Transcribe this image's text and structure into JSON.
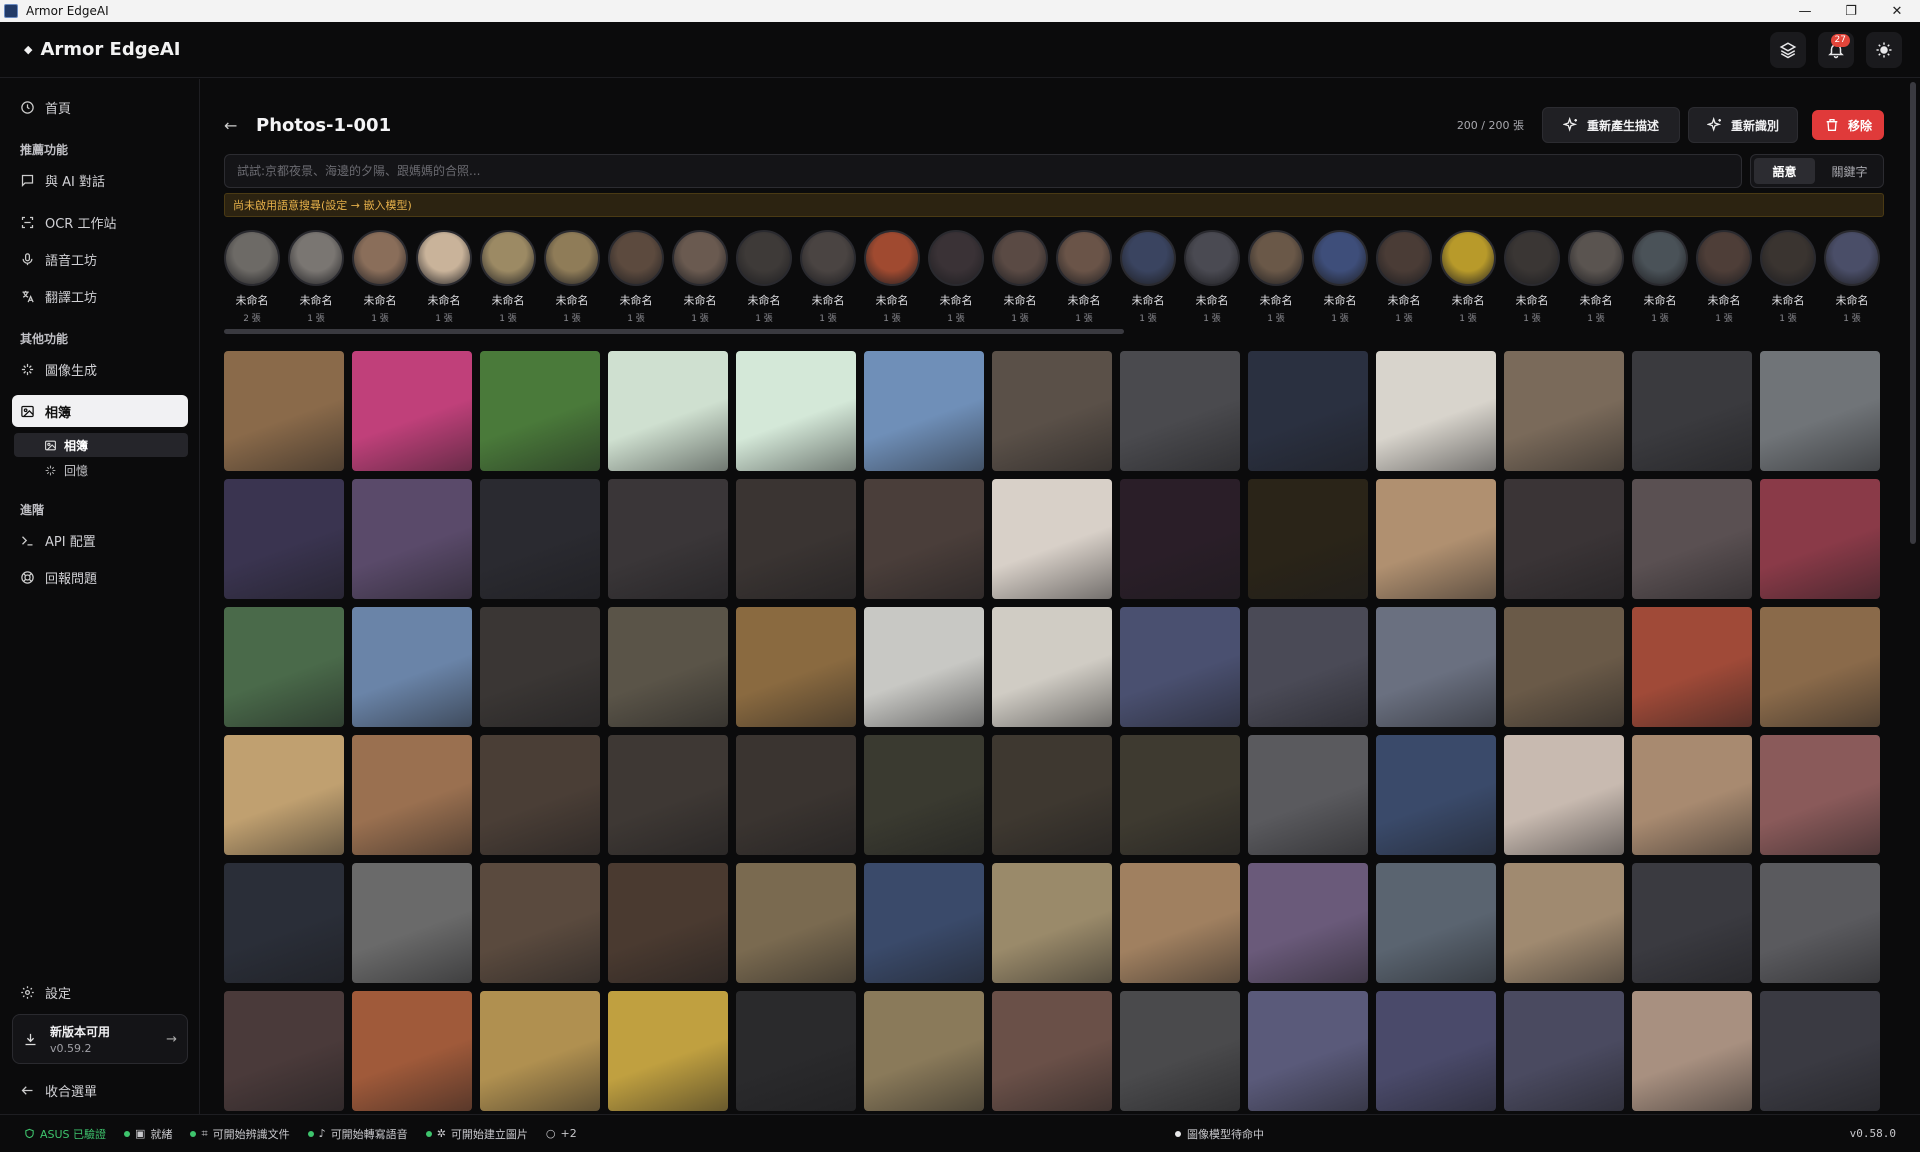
{
  "window": {
    "title": "Armor EdgeAI",
    "controls": [
      "—",
      "❐",
      "✕"
    ]
  },
  "header": {
    "brand": "Armor EdgeAI",
    "notification_count": "27"
  },
  "sidebar": {
    "home": "首頁",
    "section_recommended": "推薦功能",
    "chat": "與 AI 對話",
    "ocr": "OCR 工作站",
    "voice": "語音工坊",
    "translate": "翻譯工坊",
    "section_other": "其他功能",
    "imagegen": "圖像生成",
    "album": "相簿",
    "album_sub": "相簿",
    "memories": "回憶",
    "section_advanced": "進階",
    "api": "API 配置",
    "report": "回報問題",
    "settings": "設定",
    "update_title": "新版本可用",
    "update_version": "v0.59.2",
    "collapse": "收合選單"
  },
  "main": {
    "title": "Photos-1-001",
    "count": "200 / 200 張",
    "regen_desc": "重新產生描述",
    "reidentify": "重新識別",
    "remove": "移除",
    "search_placeholder": "試試:京都夜景、海邊的夕陽、跟媽媽的合照...",
    "mode_semantic": "語意",
    "mode_keyword": "關鍵字",
    "warning": "尚未啟用語意搜尋(設定 → 嵌入模型)"
  },
  "faces": [
    {
      "name": "未命名",
      "count": "2 張",
      "color": "#6d6a66"
    },
    {
      "name": "未命名",
      "count": "1 張",
      "color": "#7a7672"
    },
    {
      "name": "未命名",
      "count": "1 張",
      "color": "#8a6e5a"
    },
    {
      "name": "未命名",
      "count": "1 張",
      "color": "#c9b39a"
    },
    {
      "name": "未命名",
      "count": "1 張",
      "color": "#9c8a64"
    },
    {
      "name": "未命名",
      "count": "1 張",
      "color": "#8f7c58"
    },
    {
      "name": "未命名",
      "count": "1 張",
      "color": "#5c4a3e"
    },
    {
      "name": "未命名",
      "count": "1 張",
      "color": "#6a5a50"
    },
    {
      "name": "未命名",
      "count": "1 張",
      "color": "#3e3a38"
    },
    {
      "name": "未命名",
      "count": "1 張",
      "color": "#4a4442"
    },
    {
      "name": "未命名",
      "count": "1 張",
      "color": "#a04a30"
    },
    {
      "name": "未命名",
      "count": "1 張",
      "color": "#3a3236"
    },
    {
      "name": "未命名",
      "count": "1 張",
      "color": "#5a4a44"
    },
    {
      "name": "未命名",
      "count": "1 張",
      "color": "#6a5448"
    },
    {
      "name": "未命名",
      "count": "1 張",
      "color": "#3a4460"
    },
    {
      "name": "未命名",
      "count": "1 張",
      "color": "#4a4a52"
    },
    {
      "name": "未命名",
      "count": "1 張",
      "color": "#6a5848"
    },
    {
      "name": "未命名",
      "count": "1 張",
      "color": "#3e4e7a"
    },
    {
      "name": "未命名",
      "count": "1 張",
      "color": "#4a3c36"
    },
    {
      "name": "未命名",
      "count": "1 張",
      "color": "#b89a2a"
    },
    {
      "name": "未命名",
      "count": "1 張",
      "color": "#3a3634"
    },
    {
      "name": "未命名",
      "count": "1 張",
      "color": "#5a5450"
    },
    {
      "name": "未命名",
      "count": "1 張",
      "color": "#4a5258"
    },
    {
      "name": "未命名",
      "count": "1 張",
      "color": "#4e3e38"
    },
    {
      "name": "未命名",
      "count": "1 張",
      "color": "#3a3430"
    },
    {
      "name": "未命名",
      "count": "1 張",
      "color": "#4a4e68"
    }
  ],
  "photos": [
    "#8a6a4a",
    "#c0407a",
    "#4a7a3a",
    "#cfe0d0",
    "#d4e8d8",
    "#6f8fb8",
    "#5a5048",
    "#4a4a4e",
    "#2a3040",
    "#d8d4cc",
    "#7a6a5a",
    "#3a3a3e",
    "#707478",
    "#3a3450",
    "#5a4a6a",
    "#2a2a30",
    "#3a3638",
    "#3a3432",
    "#4a3e3a",
    "#d8d0c8",
    "#2a1e28",
    "#2a2418",
    "#b09070",
    "#3a3436",
    "#5a5052",
    "#8a3a48",
    "#4a6a4a",
    "#6a84a8",
    "#3a3634",
    "#5a5448",
    "#8a6a40",
    "#c8c8c4",
    "#d0ccc4",
    "#4a5070",
    "#4a4a56",
    "#6a7080",
    "#6a5a48",
    "#a04a38",
    "#8a6a4a",
    "#c0a070",
    "#9a7050",
    "#4a3e36",
    "#3e3834",
    "#3a3430",
    "#3a3a30",
    "#3e3830",
    "#3e3a30",
    "#5a5a5e",
    "#3a4a6a",
    "#c8bab0",
    "#a88a70",
    "#8a5a5a",
    "#2a2e38",
    "#6a6a6a",
    "#5a4a3e",
    "#4a3a30",
    "#7a6a50",
    "#3a4a6a",
    "#9a8a6a",
    "#a08060",
    "#6a5a7a",
    "#5a6470",
    "#a08a70",
    "#3a3a40",
    "#5a5a5e",
    "#4a3a3a",
    "#a05a3a",
    "#b09050",
    "#c0a040",
    "#2a2a2c",
    "#8a7a5a",
    "#6a5048",
    "#4a4a4c",
    "#5a5a7a",
    "#4a4a6a",
    "#4a4a60",
    "#a89080",
    "#3a3a42"
  ],
  "statusbar": {
    "verified": "ASUS 已驗證",
    "ready": "就緒",
    "doc": "可開始辨識文件",
    "speech": "可開始轉寫語音",
    "image": "可開始建立圖片",
    "more": "+2",
    "model": "圖像模型待命中",
    "version": "v0.58.0"
  }
}
